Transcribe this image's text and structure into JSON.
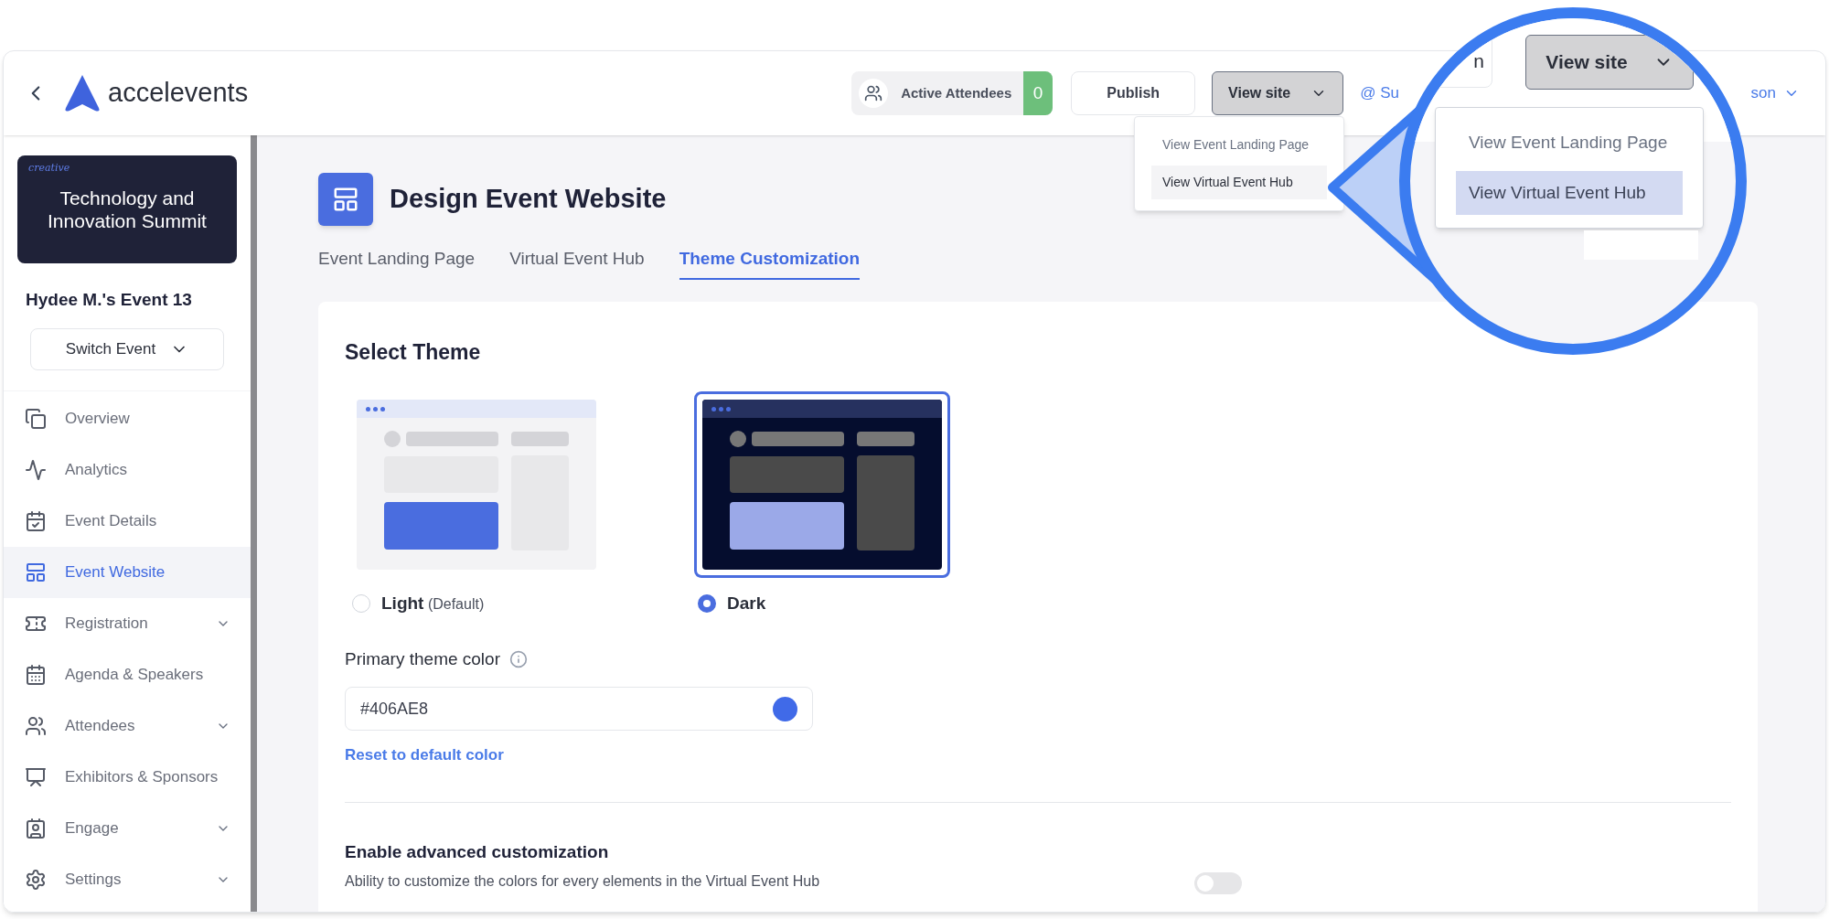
{
  "header": {
    "logo_text": "accelevents",
    "active_attendees": {
      "label": "Active Attendees",
      "count": "0"
    },
    "publish": "Publish",
    "view_site": "View site",
    "support_partial": "@ Su",
    "user_partial": "son"
  },
  "view_site_menu": [
    {
      "label": "View Event Landing Page",
      "selected": false
    },
    {
      "label": "View Virtual Event Hub",
      "selected": true
    }
  ],
  "magnifier": {
    "button_partial": "n",
    "view_site": "View site",
    "menu": [
      {
        "label": "View Event Landing Page",
        "selected": false
      },
      {
        "label": "View Virtual Event Hub",
        "selected": true
      }
    ]
  },
  "sidebar": {
    "event_banner": {
      "title": "Technology and Innovation Summit",
      "script_word": "creative"
    },
    "event_name": "Hydee M.'s Event 13",
    "switch_event": "Switch Event",
    "items": [
      {
        "label": "Overview",
        "selected": false,
        "expandable": false
      },
      {
        "label": "Analytics",
        "selected": false,
        "expandable": false
      },
      {
        "label": "Event Details",
        "selected": false,
        "expandable": false
      },
      {
        "label": "Event Website",
        "selected": true,
        "expandable": false
      },
      {
        "label": "Registration",
        "selected": false,
        "expandable": true
      },
      {
        "label": "Agenda & Speakers",
        "selected": false,
        "expandable": false
      },
      {
        "label": "Attendees",
        "selected": false,
        "expandable": true
      },
      {
        "label": "Exhibitors & Sponsors",
        "selected": false,
        "expandable": false
      },
      {
        "label": "Engage",
        "selected": false,
        "expandable": true
      },
      {
        "label": "Settings",
        "selected": false,
        "expandable": true
      }
    ]
  },
  "page": {
    "title": "Design Event Website",
    "tabs": [
      {
        "label": "Event Landing Page",
        "selected": false
      },
      {
        "label": "Virtual Event Hub",
        "selected": false
      },
      {
        "label": "Theme Customization",
        "selected": true
      }
    ]
  },
  "theme": {
    "heading": "Select Theme",
    "options": [
      {
        "kind": "light",
        "label": "Light",
        "note": "(Default)",
        "selected": false
      },
      {
        "kind": "dark",
        "label": "Dark",
        "selected": true
      }
    ],
    "primary_color": {
      "label": "Primary theme color",
      "value": "#406AE8"
    },
    "reset": "Reset to default color",
    "advanced": {
      "title": "Enable advanced customization",
      "description": "Ability to customize the colors for every elements in the Virtual Event Hub",
      "on": false
    }
  }
}
